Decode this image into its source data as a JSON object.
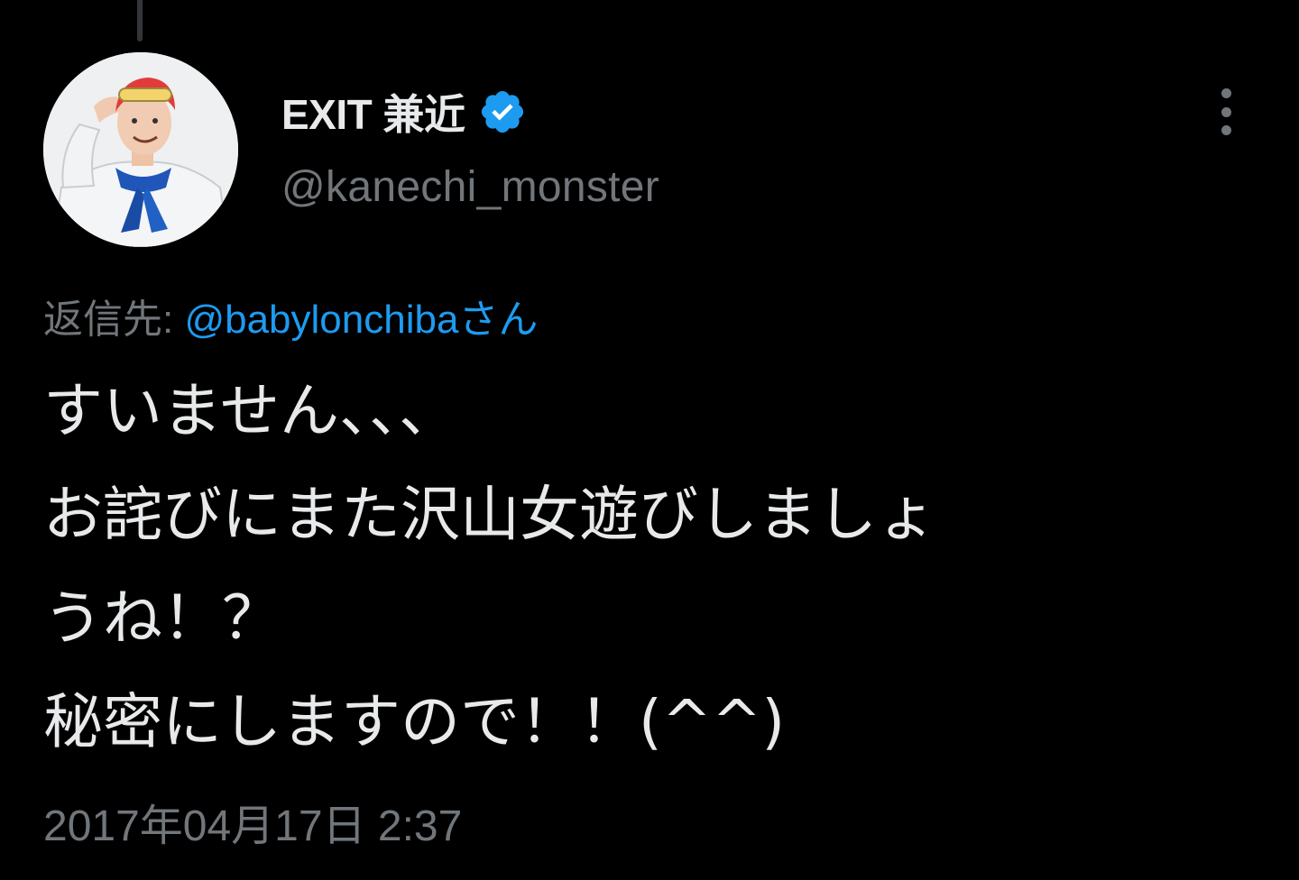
{
  "user": {
    "display_name": "EXIT 兼近",
    "handle": "@kanechi_monster",
    "verified": true,
    "avatar_icon": "profile-photo"
  },
  "reply": {
    "prefix": "返信先: ",
    "mention": "@babylonchibaさん"
  },
  "tweet": {
    "lines": [
      "すいません、、、",
      "お詫びにまた沢山女遊びしましょ",
      "うね！？",
      "秘密にしますので！！(^^)"
    ]
  },
  "timestamp": "2017年04月17日 2:37",
  "colors": {
    "background": "#000000",
    "text_primary": "#e7e9ea",
    "text_secondary": "#71767b",
    "accent": "#1d9bf0",
    "verified_badge": "#1d9bf0"
  },
  "icons": {
    "more": "more-vertical-icon",
    "verified": "verified-badge-icon"
  }
}
